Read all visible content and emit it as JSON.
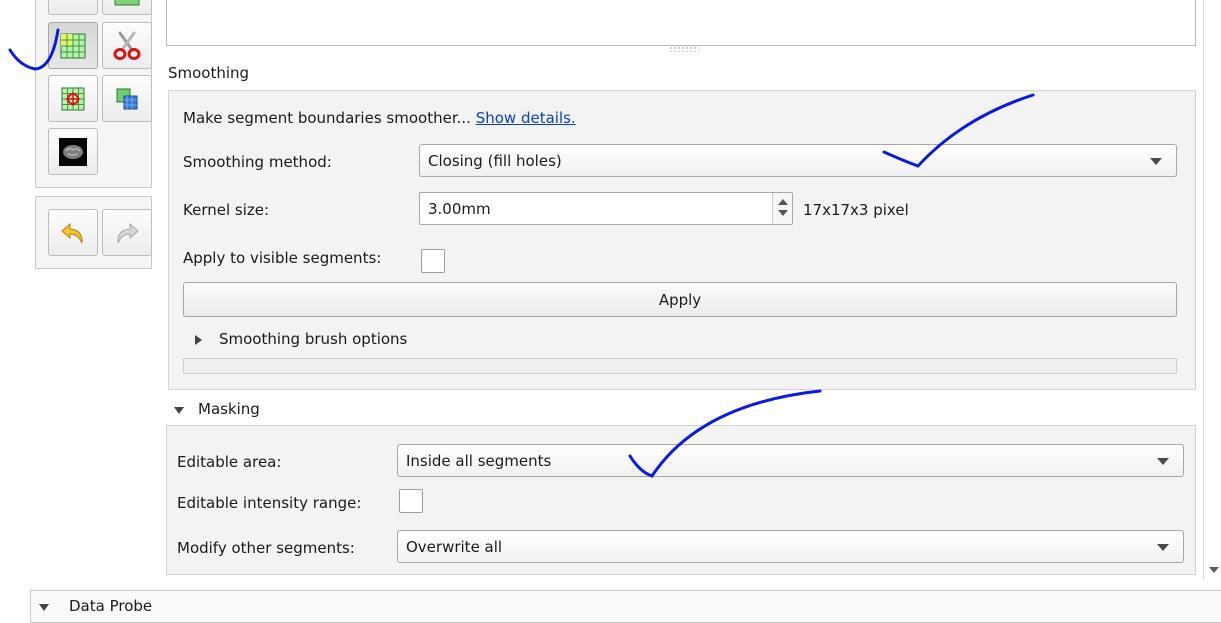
{
  "colors": {
    "link": "#0a40c8",
    "ink": "#0a1adf",
    "panel_bg": "#f3f3f3"
  },
  "tools": [
    {
      "name": "grid-threshold-icon",
      "pressed": true
    },
    {
      "name": "scissors-icon",
      "pressed": false
    },
    {
      "name": "grid-target-icon",
      "pressed": false
    },
    {
      "name": "logical-operators-icon",
      "pressed": false
    },
    {
      "name": "brain-icon",
      "pressed": false
    }
  ],
  "history": {
    "undo_icon": "undo-arrow-icon",
    "redo_icon": "redo-arrow-icon"
  },
  "smoothing": {
    "title": "Smoothing",
    "description": "Make segment boundaries smoother...",
    "details_link": "Show details.",
    "method_label": "Smoothing method:",
    "method_value": "Closing (fill holes)",
    "kernel_label": "Kernel size:",
    "kernel_value": "3.00mm",
    "kernel_pixels": "17x17x3 pixel",
    "visible_label": "Apply to visible segments:",
    "apply_label": "Apply",
    "brush_options_label": "Smoothing brush options"
  },
  "masking": {
    "title": "Masking",
    "editable_area_label": "Editable area:",
    "editable_area_value": "Inside all segments",
    "intensity_label": "Editable intensity range:",
    "modify_label": "Modify other segments:",
    "modify_value": "Overwrite all"
  },
  "data_probe": {
    "title": "Data Probe"
  }
}
